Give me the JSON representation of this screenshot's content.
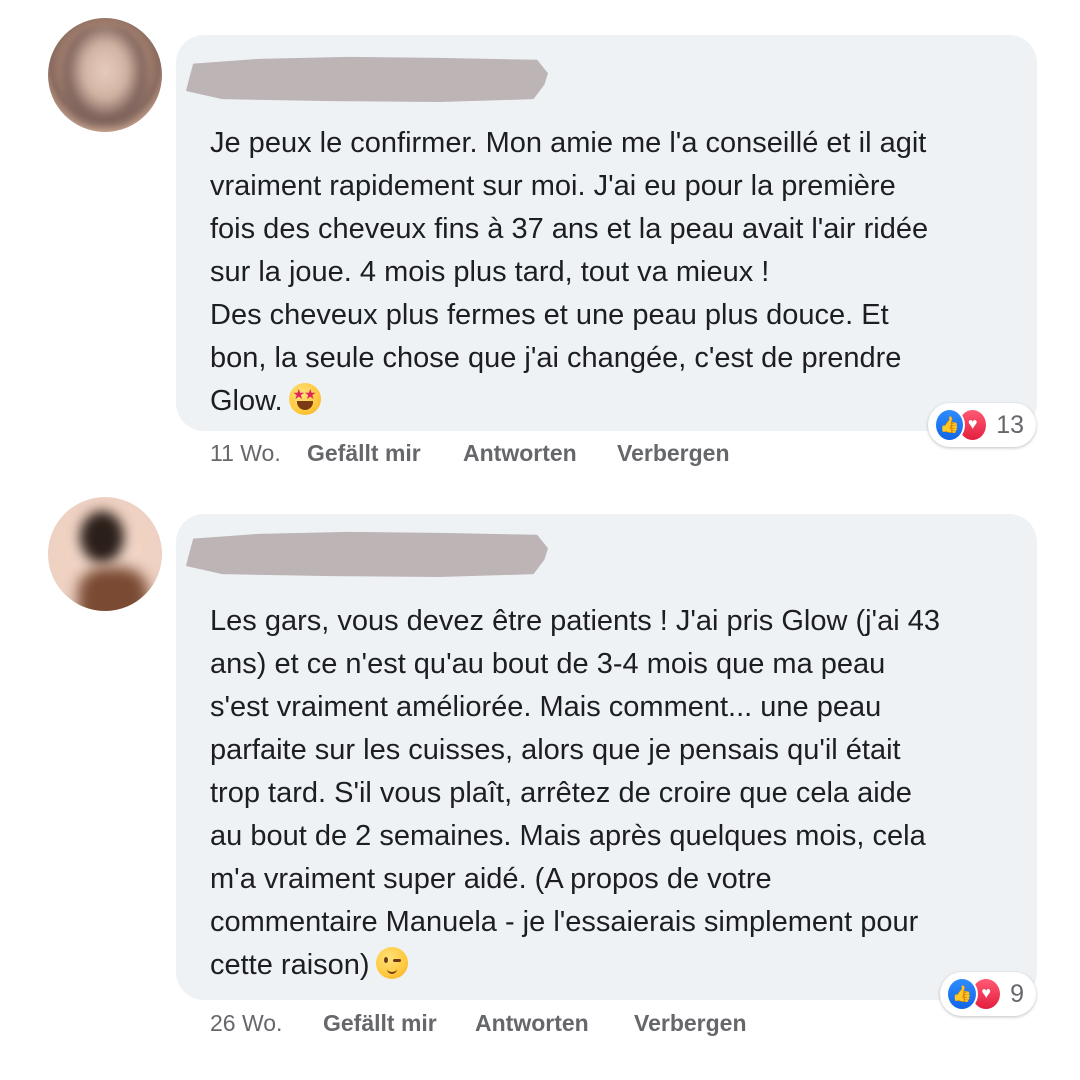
{
  "comments": [
    {
      "text": "Je peux le confirmer. Mon amie me l'a conseillé et il agit\nvraiment rapidement sur moi. J'ai eu pour la première\nfois des cheveux fins à 37 ans et la peau avait l'air ridée\nsur la joue. 4 mois plus tard, tout va mieux !\nDes cheveux plus fermes et une peau plus douce. Et\nbon, la seule chose que j'ai changée, c'est de prendre\nGlow.",
      "emoji": "star-struck-emoji",
      "reaction_count": "13",
      "time": "11 Wo.",
      "like_label": "Gefällt mir",
      "reply_label": "Antworten",
      "hide_label": "Verbergen"
    },
    {
      "text": "Les gars, vous devez être patients ! J'ai pris Glow (j'ai 43\nans) et ce n'est qu'au bout de 3-4 mois que ma peau\ns'est vraiment améliorée. Mais comment... une peau\nparfaite sur les cuisses, alors que je pensais qu'il était\ntrop tard. S'il vous plaît, arrêtez de croire que cela aide\nau bout de 2 semaines. Mais après quelques mois, cela\nm'a vraiment super aidé. (A propos de votre\ncommentaire Manuela - je l'essaierais simplement pour\ncette raison)",
      "emoji": "winking-face-emoji",
      "reaction_count": "9",
      "time": "26 Wo.",
      "like_label": "Gefällt mir",
      "reply_label": "Antworten",
      "hide_label": "Verbergen"
    }
  ],
  "icons": {
    "like": "thumbs-up-icon",
    "love": "heart-icon"
  },
  "colors": {
    "bubble": "#eff2f5",
    "like_blue": "#1877f2",
    "love_red": "#e41e3f",
    "meta_gray": "#65676b"
  }
}
